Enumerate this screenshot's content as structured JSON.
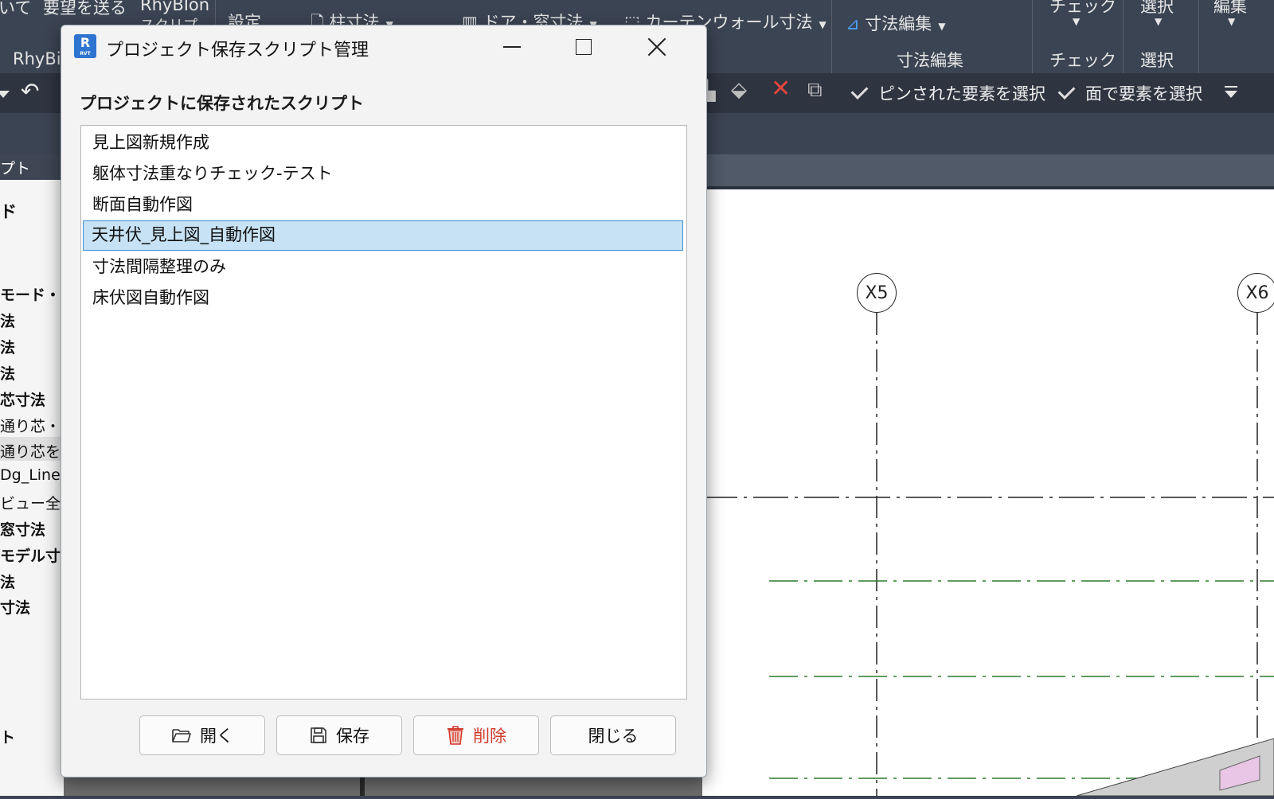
{
  "ribbon": {
    "items": [
      "いて",
      "要望を送る",
      "RhyBIon",
      "スクリプ",
      "設定",
      "柱寸法",
      "ドア・窓寸法",
      "カーテンウォール寸法",
      "寸法編集",
      "チェック",
      "選択",
      "編集"
    ],
    "panel_labels": [
      "RhyBi",
      "寸法編集",
      "チェック",
      "選択"
    ]
  },
  "toolbar": {
    "select_pinned": "ピンされた要素を選択",
    "select_face": "面で要素を選択"
  },
  "left_panel": {
    "header": "プト",
    "items": [
      "ド",
      "モード・設定",
      "法",
      "法",
      "法",
      "芯寸法",
      "通り芯・詳",
      "通り芯を選",
      "Dg_Line &",
      "ビュー全：",
      "窓寸法",
      "モデル寸法",
      "法",
      "寸法",
      "ト"
    ]
  },
  "canvas": {
    "grid_labels": [
      "X5",
      "X6"
    ]
  },
  "dialog": {
    "title": "プロジェクト保存スクリプト管理",
    "list_label": "プロジェクトに保存されたスクリプト",
    "scripts": [
      "見上図新規作成",
      "躯体寸法重なりチェック-テスト",
      "断面自動作図",
      "天井伏_見上図_自動作図",
      "寸法間隔整理のみ",
      "床伏図自動作図"
    ],
    "selected_index": 3,
    "buttons": {
      "open": "開く",
      "save": "保存",
      "delete": "削除",
      "close": "閉じる"
    }
  },
  "colors": {
    "accent_selection": "#c7e2f4",
    "selection_border": "#3d8ed8",
    "delete_red": "#d33a2c",
    "revit_blue": "#2f74d0"
  }
}
